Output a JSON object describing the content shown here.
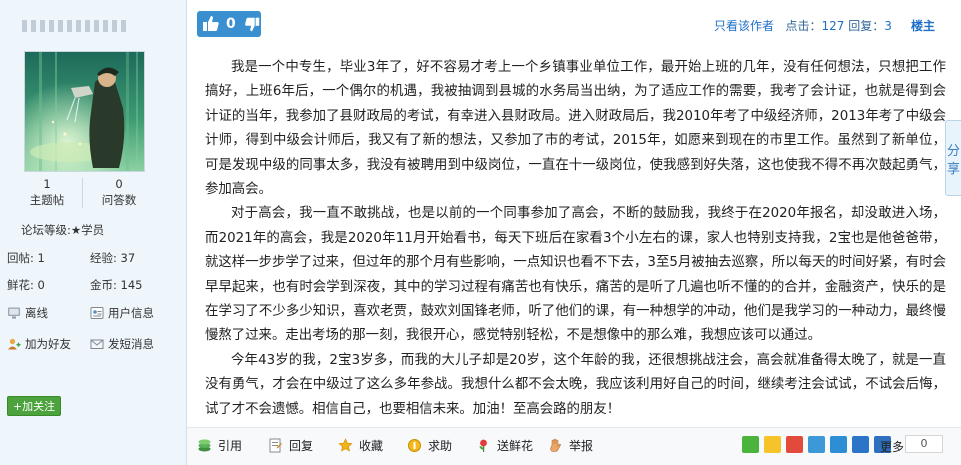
{
  "profile": {
    "stats": [
      {
        "value": "1",
        "label": "主题帖"
      },
      {
        "value": "0",
        "label": "问答数"
      }
    ],
    "level_label": "论坛等级:",
    "level_value": "★学员",
    "posts_label": "回帖:",
    "posts_value": "1",
    "exp_label": "经验:",
    "exp_value": "37",
    "flowers_label": "鲜花:",
    "flowers_value": "0",
    "coins_label": "金币:",
    "coins_value": "145",
    "actions": {
      "offline": "离线",
      "user_info": "用户信息",
      "add_friend": "加为好友",
      "send_message": "发短消息"
    },
    "follow_label": "+加关注"
  },
  "post": {
    "likes": "0",
    "only_author": "只看该作者",
    "clicks_label": "点击：",
    "clicks_value": "127",
    "replies_label": "回复：",
    "replies_value": "3",
    "floor": "楼主",
    "paragraphs": [
      "我是一个中专生，毕业3年了，好不容易才考上一个乡镇事业单位工作，最开始上班的几年，没有任何想法，只想把工作搞好，上班6年后，一个偶尔的机遇，我被抽调到县城的水务局当出纳，为了适应工作的需要，我考了会计证，也就是得到会计证的当年，我参加了县财政局的考试，有幸进入县财政局。进入财政局后，我2010年考了中级经济师，2013年考了中级会计师，得到中级会计师后，我又有了新的想法，又参加了市的考试，2015年，如愿来到现在的市里工作。虽然到了新单位，可是发现中级的同事太多，我没有被聘用到中级岗位，一直在十一级岗位，使我感到好失落，这也使我不得不再次鼓起勇气，参加高会。",
      "对于高会，我一直不敢挑战，也是以前的一个同事参加了高会，不断的鼓励我，我终于在2020年报名，却没敢进入场，而2021年的高会，我是2020年11月开始看书，每天下班后在家看3个小左右的课，家人也特别支持我，2宝也是他爸爸带，就这样一步步学了过来，但过年的那个月有些影响，一点知识也看不下去，3至5月被抽去巡察，所以每天的时间好紧，有时会早早起来，也有时会学到深夜，其中的学习过程有痛苦也有快乐，痛苦的是听了几遍也听不懂的的合并，金融资产，快乐的是在学习了不少多少知识，喜欢老贾，鼓欢刘国锋老师，听了他们的课，有一种想学的冲动，他们是我学习的一种动力，最终慢慢熬了过来。走出考场的那一刻，我很开心，感觉特别轻松，不是想像中的那么难，我想应该可以通过。",
      "今年43岁的我，2宝3岁多，而我的大儿子却是20岁，这个年龄的我，还很想挑战注会，高会就准备得太晚了，就是一直没有勇气，才会在中级过了这么多年参战。我想什么都不会太晚，我应该利用好自己的时间，继续考注会试试，不试会后悔，试了才不会遗憾。相信自己，也要相信未来。加油！至高会路的朋友！"
    ]
  },
  "bottom": {
    "quote": "引用",
    "reply": "回复",
    "favorite": "收藏",
    "help": "求助",
    "send_flower": "送鲜花",
    "report": "举报",
    "more": "更多",
    "share_count": "0"
  },
  "side_tab": "分享"
}
